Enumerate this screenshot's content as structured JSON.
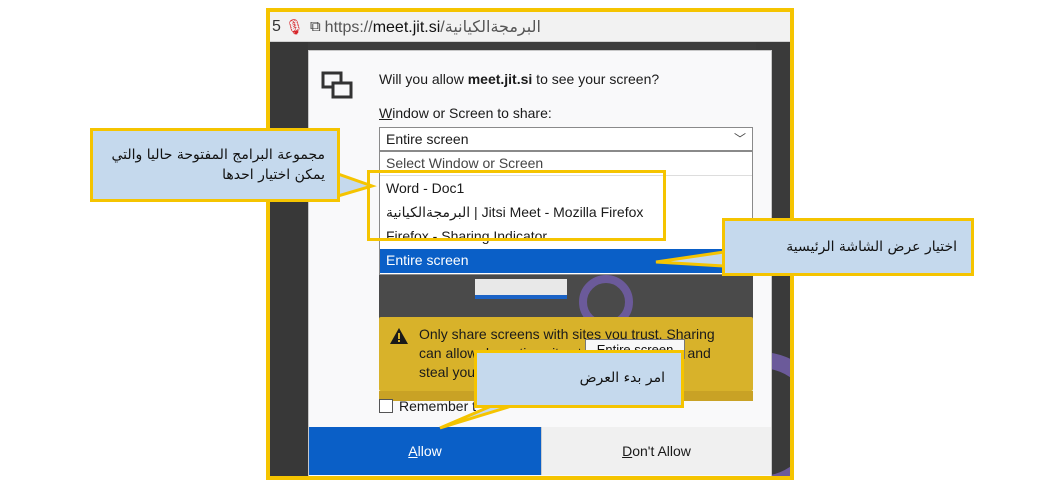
{
  "browser": {
    "tab_number": "5",
    "url_prefix": "https://",
    "url_domain": "meet.jit.si",
    "url_path": "/البرمجةالكيانية"
  },
  "dialog": {
    "question_prefix": "Will you allow ",
    "question_site": "meet.jit.si",
    "question_suffix": " to see your screen?",
    "select_label_accesskey": "W",
    "select_label_rest": "indow or Screen to share:",
    "selected_value": "Entire screen",
    "options": [
      "Select Window or Screen",
      "Word - Doc1",
      "البرمجةالكيانية | Jitsi Meet - Mozilla Firefox",
      "Firefox - Sharing Indicator",
      "Entire screen"
    ],
    "preview_tooltip": "Entire screen",
    "warning_line1": "Only share screens with sites you trust. Sharing",
    "warning_line2": "can allow deceptive sites to browse as you and",
    "warning_line3": "steal your",
    "remember_label": "Remember t",
    "allow_accesskey": "A",
    "allow_rest": "llow",
    "deny_accesskey": "D",
    "deny_rest": "on't Allow"
  },
  "callouts": {
    "apps_text": "مجموعة البرامج المفتوحة حاليا والتي يمكن اختيار احدها",
    "entire_text": "اختيار عرض الشاشة الرئيسية",
    "allow_text": "امر بدء العرض"
  },
  "colors": {
    "highlight_yellow": "#f5c400",
    "callout_fill": "#c5d9ed",
    "allow_blue": "#0a5fc7",
    "warning_yellow": "#d8b22a"
  }
}
